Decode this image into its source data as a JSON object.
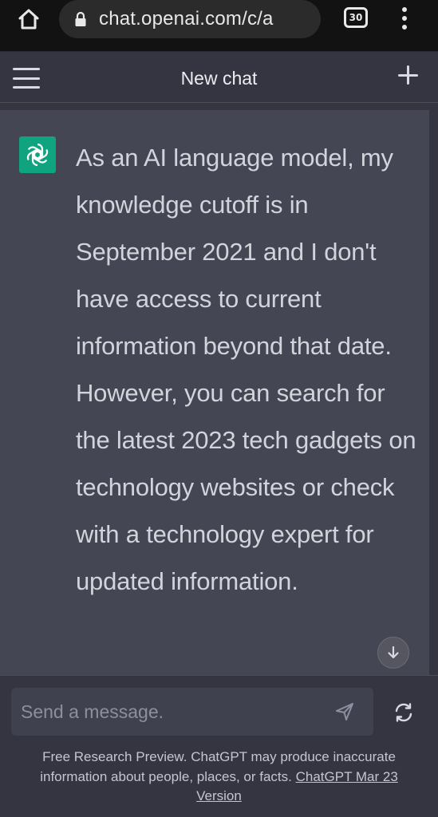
{
  "browser": {
    "url": "chat.openai.com/c/a",
    "tab_count": "30"
  },
  "header": {
    "title": "New chat"
  },
  "message": {
    "author_icon": "openai-logo-icon",
    "text": "As an AI language model, my knowledge cutoff is in September 2021 and I don't have access to current information beyond that date. However, you can search for the latest 2023 tech gadgets on technology websites or check with a technology expert for updated information."
  },
  "composer": {
    "placeholder": "Send a message."
  },
  "footer": {
    "disclaimer_text": "Free Research Preview. ChatGPT may produce inaccurate information about people, places, or facts.",
    "version_link": "ChatGPT Mar 23 Version"
  },
  "colors": {
    "accent": "#10a37f",
    "background": "#343541",
    "assistant_bg": "#444654",
    "input_bg": "#40414f"
  }
}
